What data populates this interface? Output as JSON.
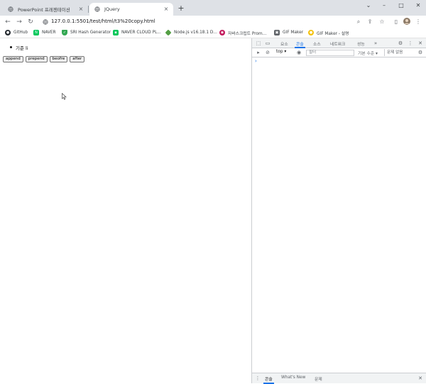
{
  "tabs": [
    {
      "title": "PowerPoint 프레젠테이션"
    },
    {
      "title": "JQuery"
    }
  ],
  "address_bar": {
    "url": "127.0.0.1:5501/test/html/t3%20copy.html"
  },
  "bookmarks": [
    {
      "label": "GitHub",
      "icon": "github-icon",
      "color": "#24292f"
    },
    {
      "label": "NAVER",
      "icon": "naver-icon",
      "color": "#03c75a"
    },
    {
      "label": "SRI Hash Generator",
      "icon": "shield-icon",
      "color": "#34a853"
    },
    {
      "label": "NAVER CLOUD PL...",
      "icon": "naver-cloud-icon",
      "color": "#03c75a"
    },
    {
      "label": "Node.js v16.18.1 D...",
      "icon": "nodejs-icon",
      "color": "#539e43"
    },
    {
      "label": "자바스크립트 Prom...",
      "icon": "javascript-icon",
      "color": "#c2185b"
    },
    {
      "label": "GIF Maker",
      "icon": "gif-maker-icon",
      "color": "#5f6368"
    },
    {
      "label": "GIF Maker - 설명",
      "icon": "gif-maker-icon",
      "color": "#f4c20d"
    }
  ],
  "page": {
    "list_items": [
      "기준 li"
    ],
    "buttons": [
      "append",
      "prepend",
      "beofre",
      "after"
    ]
  },
  "devtools": {
    "tabs": [
      "요소",
      "콘솔",
      "소스",
      "네트워크",
      "성능"
    ],
    "active_tab": "콘솔",
    "context": "top",
    "filter_placeholder": "필터",
    "levels": "기본 수준",
    "issues": "문제 없음",
    "prompt": "›",
    "drawer_tabs": [
      "콘솔",
      "What's New",
      "문제"
    ]
  },
  "colors": {
    "accent": "#1a73e8",
    "tabstrip": "#dee1e6"
  }
}
